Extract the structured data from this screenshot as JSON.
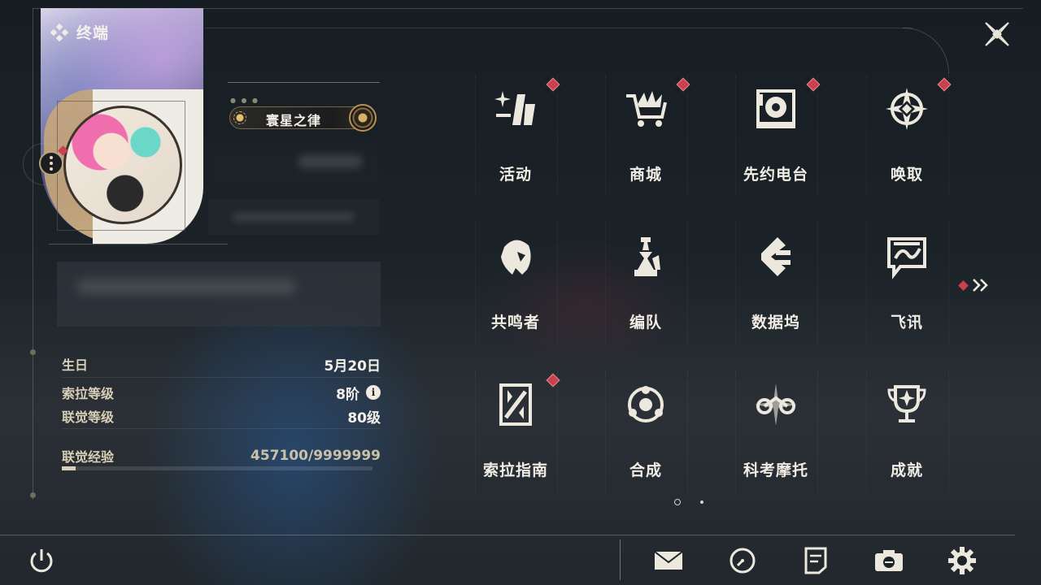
{
  "header": {
    "title": "终端"
  },
  "profile": {
    "badge_title": "寰星之律"
  },
  "stats": {
    "birthday_label": "生日",
    "birthday_value": "5月20日",
    "sola_level_label": "索拉等级",
    "sola_level_value": "8阶",
    "union_level_label": "联觉等级",
    "union_level_value": "80级",
    "union_exp_label": "联觉经验",
    "union_exp_value": "457100/9999999",
    "union_exp_fraction": 0.0457
  },
  "grid": {
    "items": [
      {
        "label": "活动",
        "icon": "sparkle-icon",
        "has_alert": true
      },
      {
        "label": "商城",
        "icon": "cart-icon",
        "has_alert": true
      },
      {
        "label": "先约电台",
        "icon": "radio-icon",
        "has_alert": true
      },
      {
        "label": "唤取",
        "icon": "compass-star-icon",
        "has_alert": true
      },
      {
        "label": "共鸣者",
        "icon": "character-icon",
        "has_alert": false
      },
      {
        "label": "编队",
        "icon": "chess-icon",
        "has_alert": false
      },
      {
        "label": "数据坞",
        "icon": "data-dock-icon",
        "has_alert": false
      },
      {
        "label": "飞讯",
        "icon": "chat-bubble-icon",
        "has_alert": false
      },
      {
        "label": "索拉指南",
        "icon": "guide-book-icon",
        "has_alert": true
      },
      {
        "label": "合成",
        "icon": "synthesis-icon",
        "has_alert": false
      },
      {
        "label": "科考摩托",
        "icon": "motorbike-icon",
        "has_alert": false
      },
      {
        "label": "成就",
        "icon": "trophy-icon",
        "has_alert": false
      }
    ],
    "page_count": 2,
    "current_page": 1
  },
  "bottom_bar": {
    "icons": [
      "power-icon",
      "mail-icon",
      "clock-icon",
      "notes-icon",
      "camera-icon",
      "settings-gear-icon"
    ]
  },
  "colors": {
    "accent_gold": "#d8cfb6",
    "alert_red": "#c8414e",
    "text_primary": "#f1ede4"
  }
}
